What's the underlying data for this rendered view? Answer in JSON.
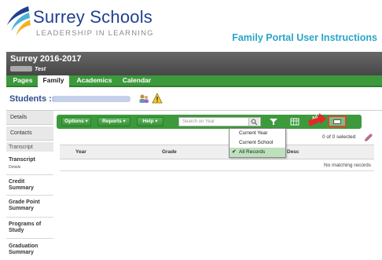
{
  "brand": {
    "name": "Surrey Schools",
    "tagline": "LEADERSHIP IN LEARNING",
    "portal_title": "Family Portal User Instructions",
    "colors": {
      "navy": "#1f3f8f",
      "teal": "#2aa5c8",
      "green": "#3c9a3c",
      "yellow": "#f4b324"
    }
  },
  "app_bar": {
    "school_year": "Surrey 2016-2017",
    "user_suffix": "Test"
  },
  "tabs": [
    {
      "label": "Pages",
      "active": false
    },
    {
      "label": "Family",
      "active": true
    },
    {
      "label": "Academics",
      "active": false
    },
    {
      "label": "Calendar",
      "active": false
    }
  ],
  "students": {
    "label": "Students ::",
    "icons": [
      "people-icon",
      "alert-icon"
    ]
  },
  "sidebar": {
    "tabs": [
      "Details",
      "Contacts"
    ],
    "heading": "Transcript",
    "items": [
      {
        "label": "Transcript",
        "sub": "Details",
        "active": true
      },
      {
        "label": "Credit Summary"
      },
      {
        "label": "Grade Point Summary"
      },
      {
        "label": "Programs of Study"
      },
      {
        "label": "Graduation Summary"
      }
    ]
  },
  "toolbar": {
    "options_label": "Options",
    "reports_label": "Reports",
    "help_label": "Help",
    "search_placeholder": "Search on Year",
    "badge_text": "Ad",
    "icons": [
      "search-icon",
      "filter-icon",
      "grid-icon",
      "columns-icon"
    ]
  },
  "records_menu": {
    "items": [
      "Current Year",
      "Current School",
      "All Records"
    ],
    "selected": "All Records"
  },
  "selection": {
    "text": "0 of 0 selected"
  },
  "table": {
    "columns": [
      "Year",
      "Grade",
      "Desc"
    ],
    "empty_message": "No matching records"
  }
}
